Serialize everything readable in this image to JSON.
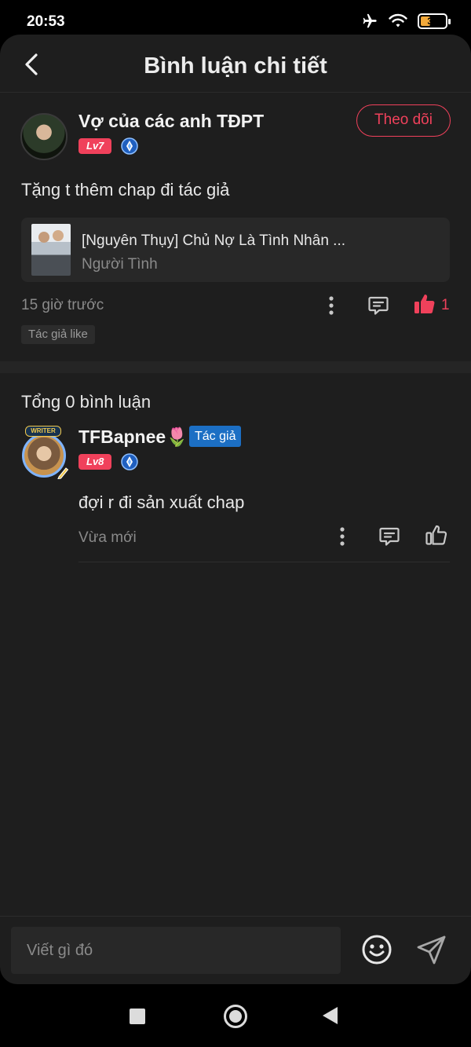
{
  "status_bar": {
    "time": "20:53",
    "battery": "38",
    "icons": [
      "airplane-icon",
      "wifi-icon",
      "battery-icon"
    ]
  },
  "header": {
    "title": "Bình luận chi tiết",
    "back_icon": "chevron-left-icon"
  },
  "main_comment": {
    "username": "Vợ của các anh TĐPT",
    "level": "Lv7",
    "follow_label": "Theo dõi",
    "text": "Tặng t thêm chap đi tác giả",
    "story": {
      "title": "[Nguyên Thụy] Chủ Nợ Là Tình Nhân ...",
      "subtitle": "Người Tình"
    },
    "time": "15 giờ trước",
    "like_count": "1",
    "author_like_tag": "Tác giả like"
  },
  "replies": {
    "total_label": "Tổng 0 bình luận",
    "items": [
      {
        "username": "TFBapnee🌷",
        "author_badge": "Tác giả",
        "level": "Lv8",
        "avatar_frame_label": "WRITER",
        "text": "đợi r đi sản xuất chap",
        "time": "Vừa mới"
      }
    ]
  },
  "composer": {
    "placeholder": "Viết gì đó"
  },
  "colors": {
    "accent": "#f0415b",
    "author_badge": "#1c6fc4",
    "background": "#1e1e1e",
    "muted_text": "#8a8a8a"
  }
}
